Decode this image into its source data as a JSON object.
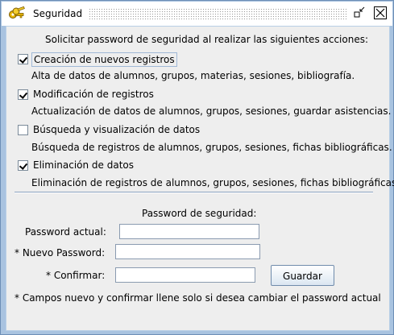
{
  "window": {
    "title": "Seguridad",
    "icon": "keys-icon",
    "controls": [
      "restore-icon",
      "close-icon"
    ]
  },
  "heading": "Solicitar password de seguridad al realizar las siguientes acciones:",
  "options": [
    {
      "label": "Creación de nuevos registros",
      "checked": true,
      "description": "Alta de datos de alumnos, grupos, materias, sesiones, bibliografía."
    },
    {
      "label": "Modificación de registros",
      "checked": true,
      "description": "Actualización de datos de alumnos, grupos, sesiones, guardar asistencias."
    },
    {
      "label": "Búsqueda y visualización de datos",
      "checked": false,
      "description": "Búsqueda de registros de alumnos, grupos, sesiones, fichas bibliográficas."
    },
    {
      "label": "Eliminación de datos",
      "checked": true,
      "description": "Eliminación de registros de alumnos, grupos, sesiones, fichas bibliográficas."
    }
  ],
  "password_section": {
    "title": "Password de seguridad:",
    "current_label": "Password actual:",
    "current_value": "",
    "new_label": "* Nuevo Password:",
    "new_value": "",
    "confirm_label": "* Confirmar:",
    "confirm_value": "",
    "save_button": "Guardar",
    "note": "* Campos nuevo y confirmar llene solo si desea cambiar el password actual"
  },
  "colors": {
    "frame": "#a9c3e0",
    "panel": "#eeeeee",
    "separator": "#8aa3c0"
  }
}
